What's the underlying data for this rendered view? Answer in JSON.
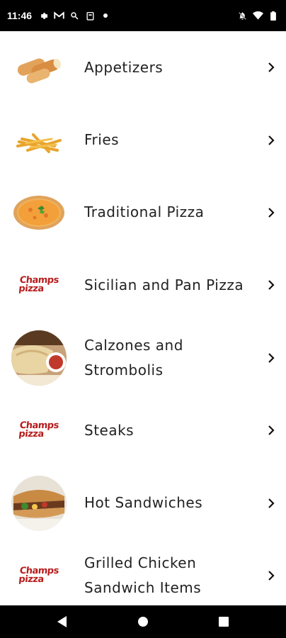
{
  "status": {
    "time": "11:46"
  },
  "menu": {
    "items": [
      {
        "label": "Appetizers",
        "icon": "mozzarella-sticks-image"
      },
      {
        "label": "Fries",
        "icon": "fries-image"
      },
      {
        "label": "Traditional Pizza",
        "icon": "pizza-image"
      },
      {
        "label": "Sicilian and Pan Pizza",
        "icon": "champs-pizza-logo"
      },
      {
        "label": "Calzones and Strombolis",
        "icon": "calzone-image"
      },
      {
        "label": "Steaks",
        "icon": "champs-pizza-logo"
      },
      {
        "label": "Hot Sandwiches",
        "icon": "sandwich-image"
      },
      {
        "label": "Grilled Chicken Sandwich Items",
        "icon": "champs-pizza-logo"
      }
    ]
  },
  "logo": {
    "line1": "Champs",
    "line2": "pizza"
  },
  "colors": {
    "logo_red": "#b71c1c",
    "bar_black": "#000000"
  }
}
